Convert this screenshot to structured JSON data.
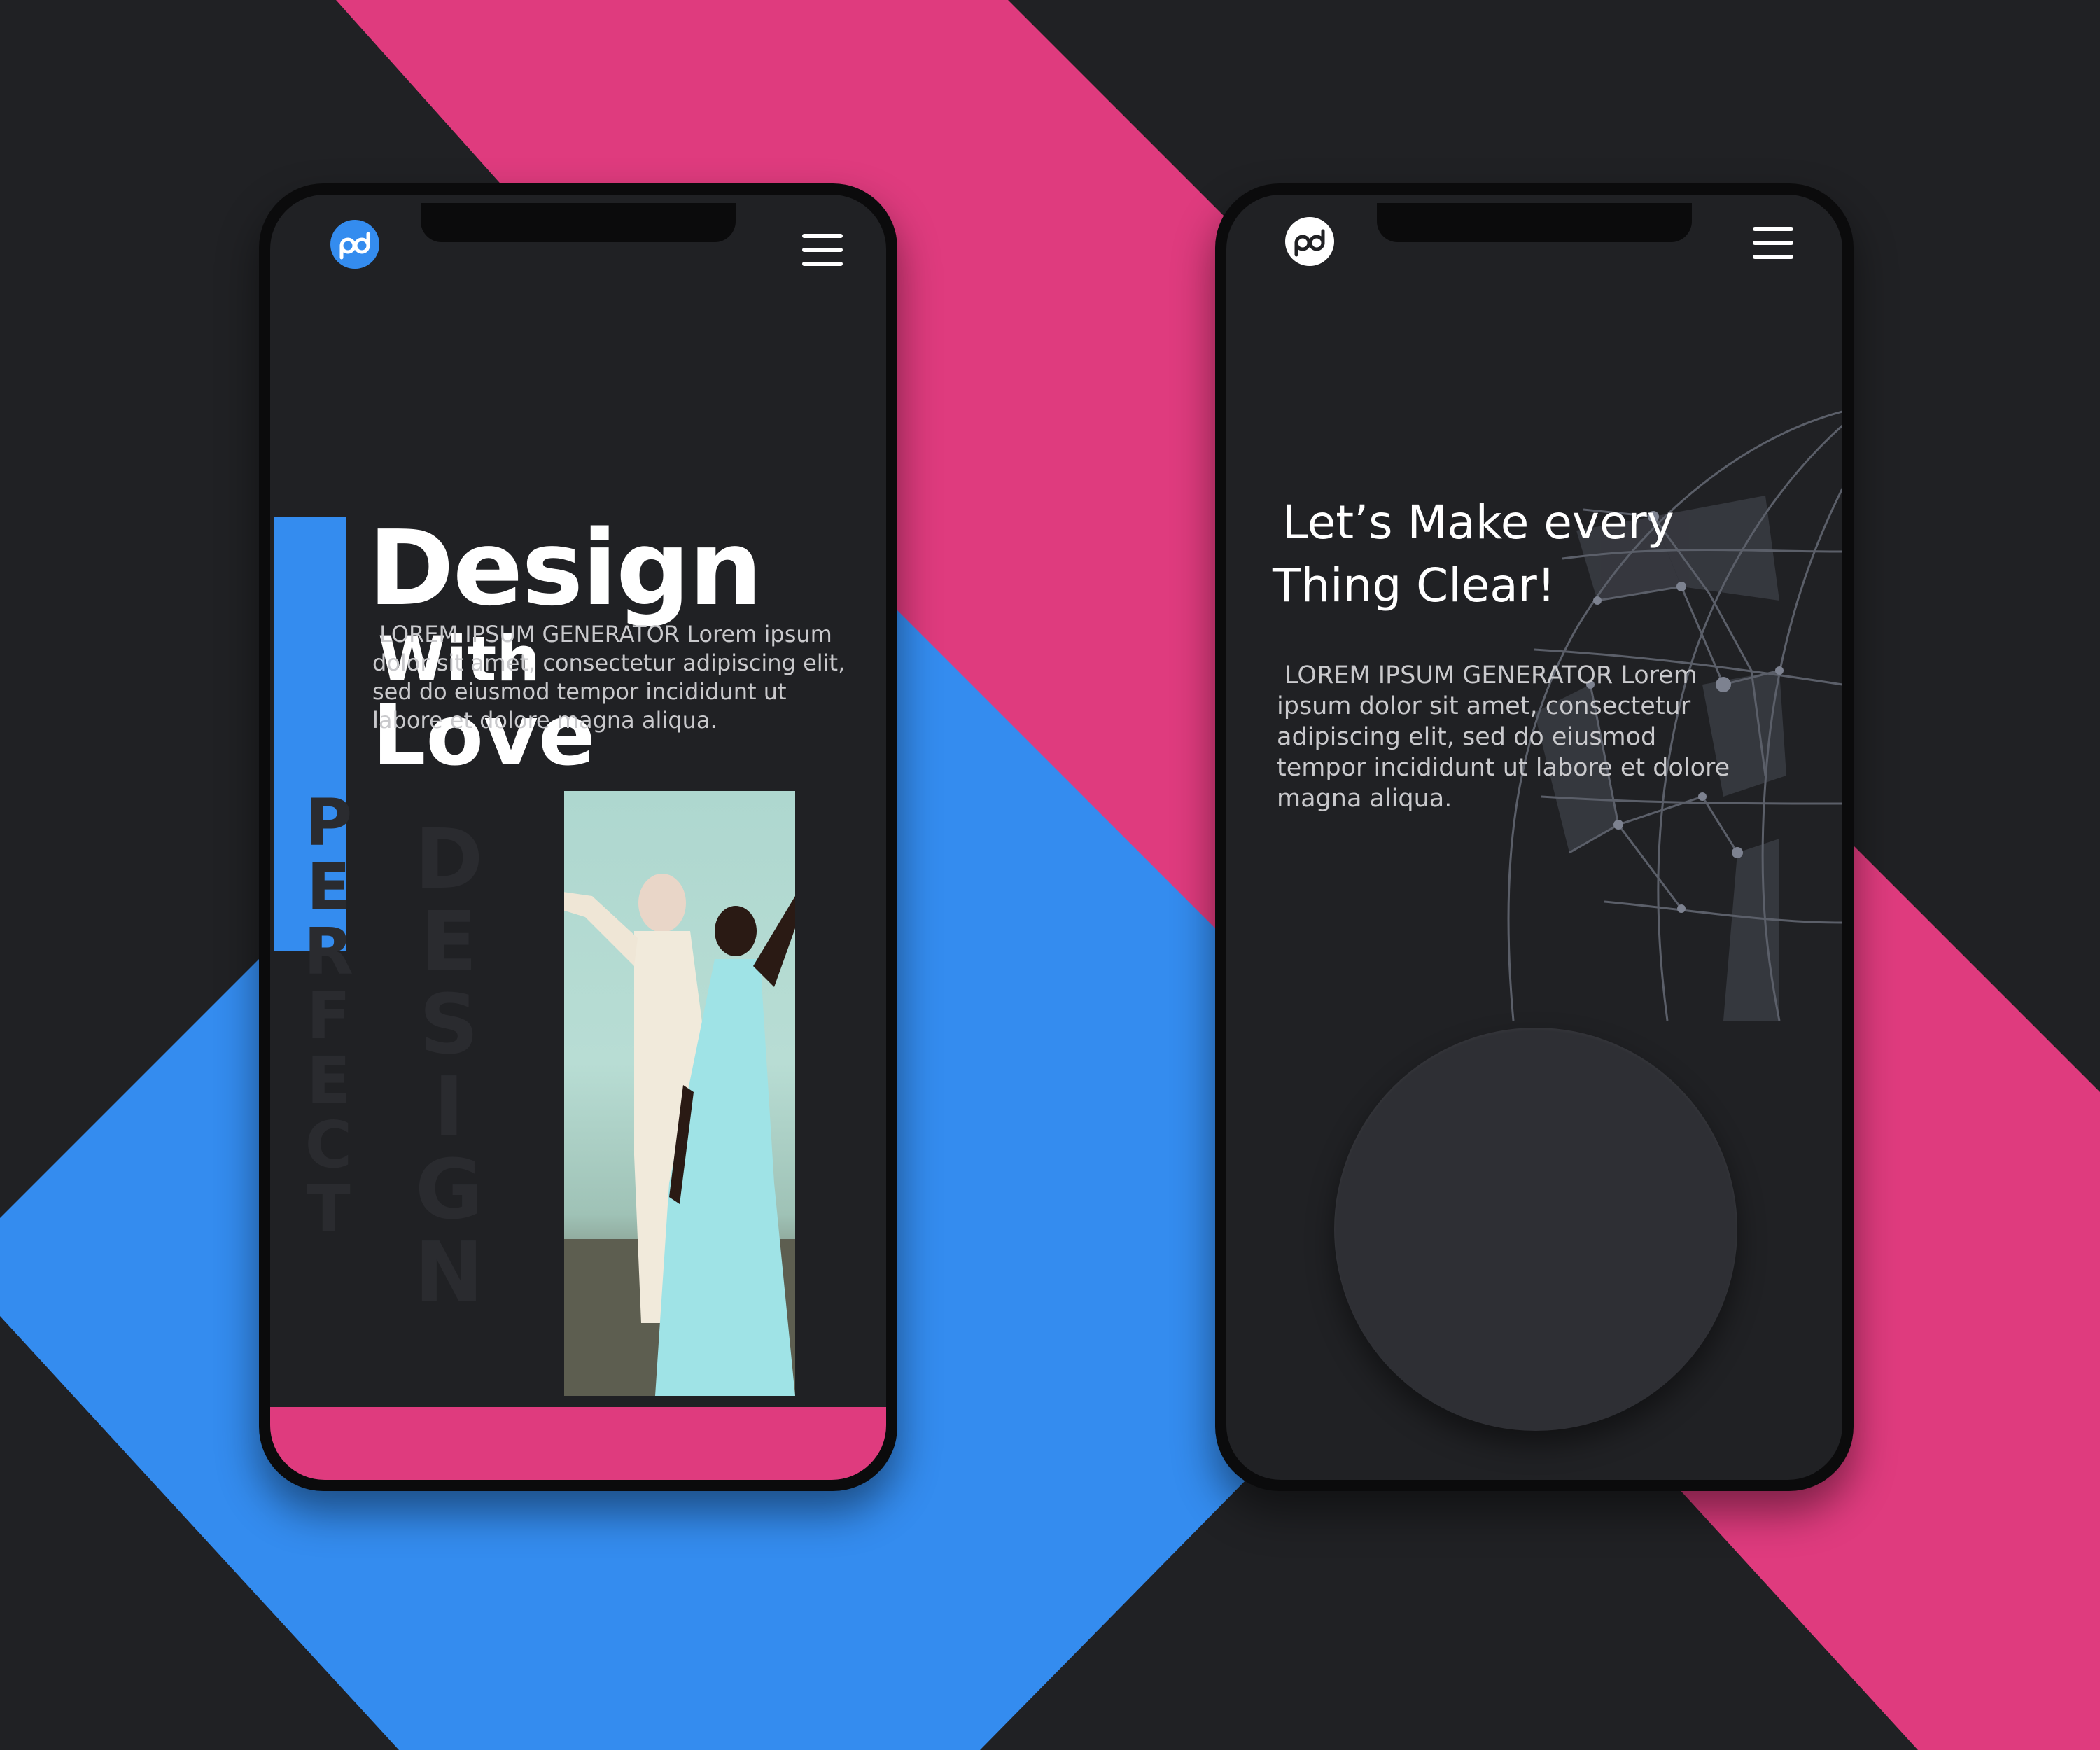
{
  "colors": {
    "background": "#202124",
    "brand_pink": "#df3b7e",
    "brand_blue": "#348cef",
    "screen": "#202124",
    "frame": "#0b0b0c",
    "text": "#ffffff",
    "muted_text": "#c9c9cc"
  },
  "left_screen": {
    "logo": {
      "icon": "pd-logo-icon",
      "text": "pd"
    },
    "menu_icon": "hamburger-menu-icon",
    "headline": {
      "line1": "Design",
      "line2": "With",
      "line3": "Love"
    },
    "body": "LOREM IPSUM GENERATOR Lorem ipsum dolor sit amet, consectetur adipiscing elit, sed do eiusmod tempor incididunt ut labore et dolore magna aliqua.",
    "vertical_words": {
      "word1": "PERFECT",
      "word2": "DESIGN"
    },
    "photo": {
      "description": "two-dancers-photo"
    }
  },
  "right_screen": {
    "logo": {
      "icon": "pd-logo-icon",
      "text": "pd"
    },
    "menu_icon": "hamburger-menu-icon",
    "heading": {
      "line1": "Let’s Make every",
      "line2": "Thing Clear!"
    },
    "body": "LOREM IPSUM GENERATOR Lorem ipsum dolor sit amet, consectetur adipiscing elit, sed do eiusmod tempor incididunt ut labore et dolore magna aliqua.",
    "decoration_icon": "wireframe-globe-icon",
    "button_icon": "circle-button"
  }
}
